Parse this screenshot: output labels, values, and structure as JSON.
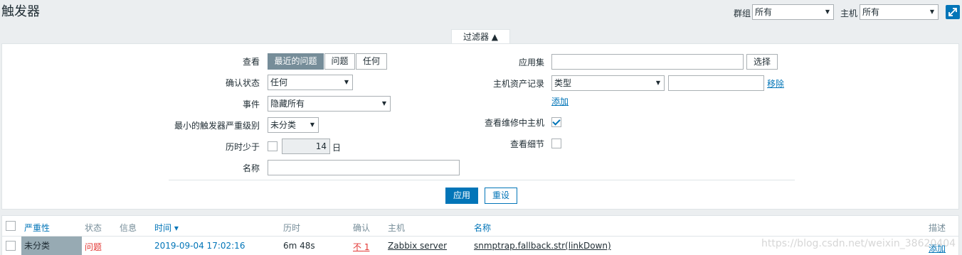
{
  "header": {
    "title": "触发器",
    "group_label": "群组",
    "group_value": "所有",
    "host_label": "主机",
    "host_value": "所有"
  },
  "filter": {
    "tab_label": "过滤器 ▲",
    "view_label": "查看",
    "view_options": [
      "最近的问题",
      "问题",
      "任何"
    ],
    "ack_label": "确认状态",
    "ack_value": "任何",
    "events_label": "事件",
    "events_value": "隐藏所有",
    "min_severity_label": "最小的触发器严重级别",
    "min_severity_value": "未分类",
    "age_label": "历时少于",
    "age_value": "14",
    "age_unit": "日",
    "name_label": "名称",
    "name_value": "",
    "app_label": "应用集",
    "app_value": "",
    "select_button": "选择",
    "inventory_label": "主机资产记录",
    "inventory_field": "类型",
    "inventory_value": "",
    "remove_link": "移除",
    "add_link": "添加",
    "maintenance_label": "查看维修中主机",
    "details_label": "查看细节",
    "apply_button": "应用",
    "reset_button": "重设"
  },
  "table": {
    "columns": [
      "严重性",
      "状态",
      "信息",
      "时间 ▾",
      "历时",
      "确认",
      "主机",
      "名称",
      "描述"
    ],
    "rows": [
      {
        "severity": "未分类",
        "status": "问题",
        "info": "",
        "time": "2019-09-04 17:02:16",
        "age": "6m 48s",
        "ack": "不",
        "ack_count": "1",
        "host": "Zabbix server",
        "name": "snmptrap.fallback.str(linkDown)",
        "description": "添加"
      }
    ]
  },
  "watermark": "https://blog.csdn.net/weixin_38620404",
  "colors": {
    "accent": "#0275b8",
    "problem": "#e33734",
    "severity_not_classified": "#97aab3"
  }
}
